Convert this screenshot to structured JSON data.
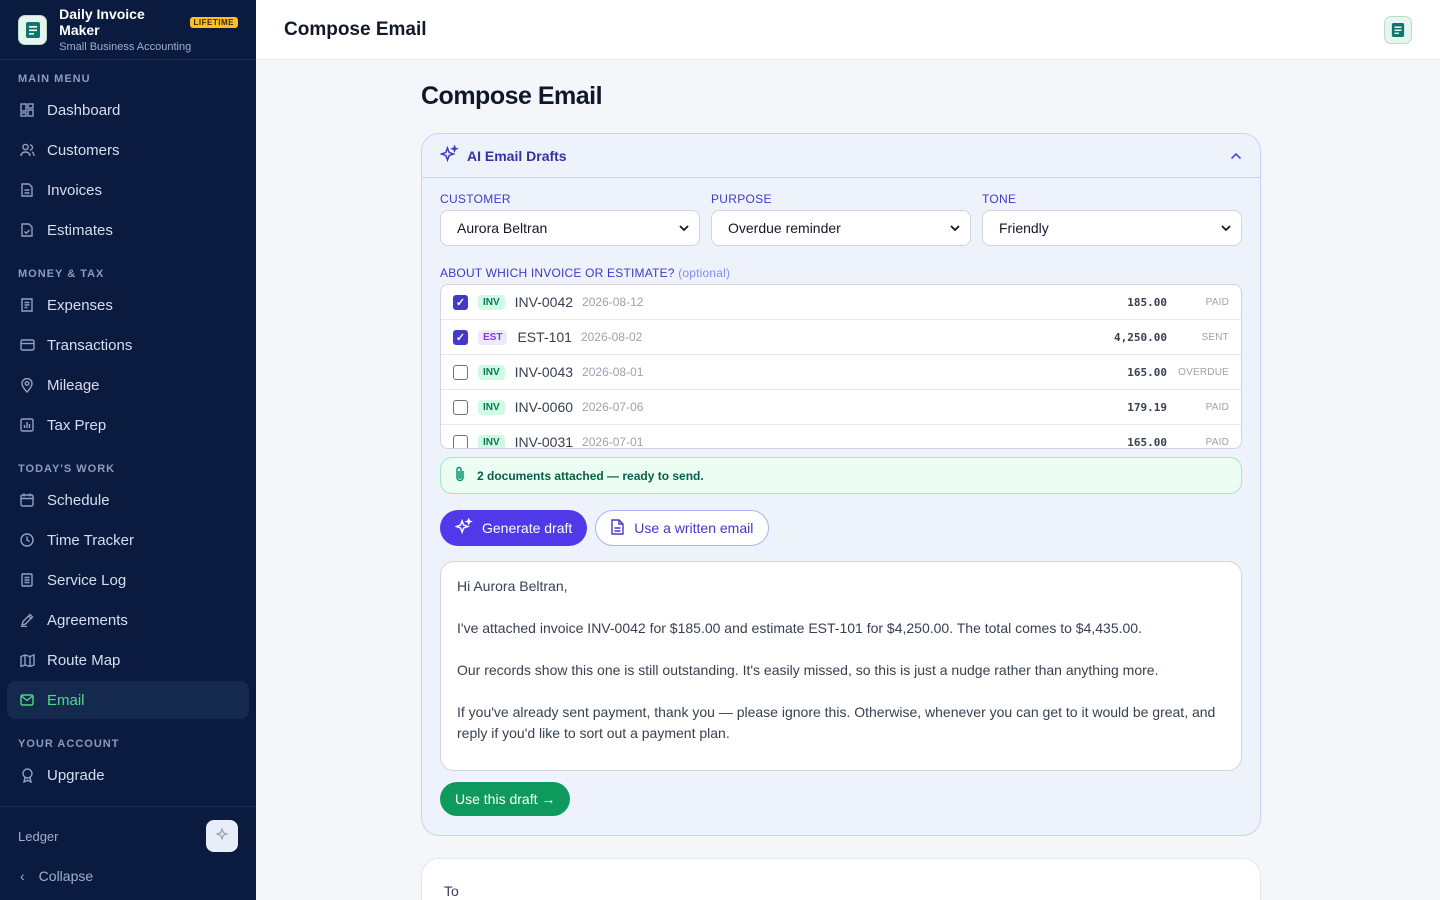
{
  "brand": {
    "title": "Daily Invoice Maker",
    "badge": "LIFETIME",
    "subtitle": "Small Business Accounting"
  },
  "sidebar": {
    "sections": [
      {
        "label": "MAIN MENU",
        "items": [
          {
            "label": "Dashboard",
            "icon": "dashboard-icon"
          },
          {
            "label": "Customers",
            "icon": "users-icon"
          },
          {
            "label": "Invoices",
            "icon": "document-icon"
          },
          {
            "label": "Estimates",
            "icon": "document-check-icon"
          }
        ]
      },
      {
        "label": "MONEY & TAX",
        "items": [
          {
            "label": "Expenses",
            "icon": "receipt-icon"
          },
          {
            "label": "Transactions",
            "icon": "card-icon"
          },
          {
            "label": "Mileage",
            "icon": "pin-icon"
          },
          {
            "label": "Tax Prep",
            "icon": "chart-icon"
          }
        ]
      },
      {
        "label": "TODAY'S WORK",
        "items": [
          {
            "label": "Schedule",
            "icon": "calendar-icon"
          },
          {
            "label": "Time Tracker",
            "icon": "clock-icon"
          },
          {
            "label": "Service Log",
            "icon": "list-icon"
          },
          {
            "label": "Agreements",
            "icon": "pen-icon"
          },
          {
            "label": "Route Map",
            "icon": "map-icon"
          },
          {
            "label": "Email",
            "icon": "mail-icon",
            "active": true
          }
        ]
      },
      {
        "label": "YOUR ACCOUNT",
        "items": [
          {
            "label": "Upgrade",
            "icon": "award-icon"
          }
        ]
      }
    ],
    "footer": {
      "ledger_label": "Ledger",
      "collapse_label": "Collapse"
    }
  },
  "topbar": {
    "title": "Compose Email"
  },
  "main": {
    "page_title": "Compose Email",
    "ai": {
      "header": "AI Email Drafts",
      "customer_label": "CUSTOMER",
      "customer_value": "Aurora Beltran",
      "purpose_label": "PURPOSE",
      "purpose_value": "Overdue reminder",
      "tone_label": "TONE",
      "tone_value": "Friendly",
      "about_label": "ABOUT WHICH INVOICE OR ESTIMATE?",
      "about_optional": "(optional)",
      "documents": [
        {
          "checked": true,
          "type": "INV",
          "number": "INV-0042",
          "date": "2026-08-12",
          "amount": "185.00",
          "status": "PAID"
        },
        {
          "checked": true,
          "type": "EST",
          "number": "EST-101",
          "date": "2026-08-02",
          "amount": "4,250.00",
          "status": "SENT"
        },
        {
          "checked": false,
          "type": "INV",
          "number": "INV-0043",
          "date": "2026-08-01",
          "amount": "165.00",
          "status": "OVERDUE"
        },
        {
          "checked": false,
          "type": "INV",
          "number": "INV-0060",
          "date": "2026-07-06",
          "amount": "179.19",
          "status": "PAID"
        },
        {
          "checked": false,
          "type": "INV",
          "number": "INV-0031",
          "date": "2026-07-01",
          "amount": "165.00",
          "status": "PAID"
        }
      ],
      "attach_status": "2 documents attached — ready to send.",
      "generate_label": "Generate draft",
      "written_label": "Use a written email",
      "draft_paragraphs": [
        "Hi Aurora Beltran,",
        "I've attached invoice INV-0042 for $185.00 and estimate EST-101 for $4,250.00. The total comes to $4,435.00.",
        "Our records show this one is still outstanding. It's easily missed, so this is just a nudge rather than anything more.",
        "If you've already sent payment, thank you — please ignore this. Otherwise, whenever you can get to it would be great, and reply if you'd like to sort out a payment plan."
      ],
      "use_draft_label": "Use this draft →"
    },
    "to_label": "To"
  },
  "colors": {
    "sidebar_bg": "#0b1a3f",
    "accent": "#4f39e8",
    "active_nav": "#4ade80",
    "success": "#0e9a5c"
  }
}
